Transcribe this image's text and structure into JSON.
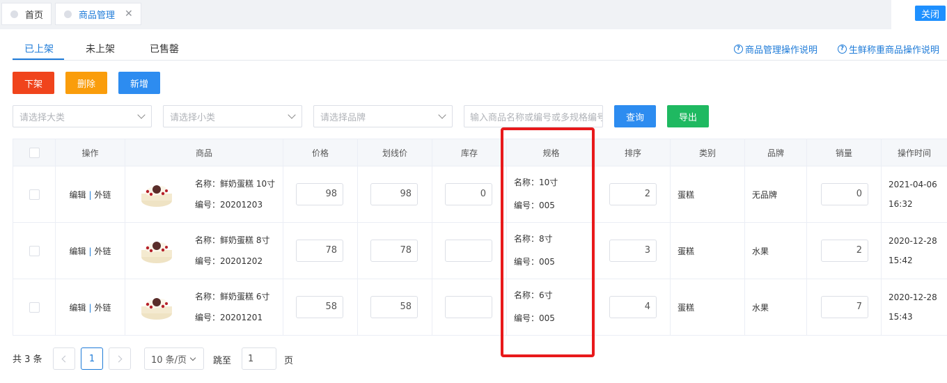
{
  "tabs": [
    {
      "label": "首页"
    },
    {
      "label": "商品管理"
    }
  ],
  "close_button": "关闭",
  "subtabs": [
    "已上架",
    "未上架",
    "已售罄"
  ],
  "help_links": [
    "商品管理操作说明",
    "生鲜称重商品操作说明"
  ],
  "actions": {
    "offshelf": "下架",
    "delete": "删除",
    "add": "新增"
  },
  "filters": {
    "category": "请选择大类",
    "subcategory": "请选择小类",
    "brand": "请选择品牌",
    "search_placeholder": "输入商品名称或编号或多规格编号",
    "query": "查询",
    "export": "导出"
  },
  "table": {
    "headers": [
      "操作",
      "商品",
      "价格",
      "划线价",
      "库存",
      "规格",
      "排序",
      "类别",
      "品牌",
      "销量",
      "操作时间"
    ],
    "edit_label": "编辑",
    "link_label": "外链",
    "rows": [
      {
        "name": "名称：鲜奶蛋糕 10寸",
        "code": "编号：20201203",
        "price": "98",
        "list_price": "98",
        "stock": "0",
        "spec_name": "名称：10寸",
        "spec_code": "编号：005",
        "sort": "2",
        "category": "蛋糕",
        "brand": "无品牌",
        "sales": "0",
        "date": "2021-04-06",
        "time": "16:32"
      },
      {
        "name": "名称：鲜奶蛋糕 8寸",
        "code": "编号：20201202",
        "price": "78",
        "list_price": "78",
        "stock": "",
        "spec_name": "名称：8寸",
        "spec_code": "编号：005",
        "sort": "3",
        "category": "蛋糕",
        "brand": "水果",
        "sales": "2",
        "date": "2020-12-28",
        "time": "15:42"
      },
      {
        "name": "名称：鲜奶蛋糕 6寸",
        "code": "编号：20201201",
        "price": "58",
        "list_price": "58",
        "stock": "",
        "spec_name": "名称：6寸",
        "spec_code": "编号：005",
        "sort": "4",
        "category": "蛋糕",
        "brand": "水果",
        "sales": "7",
        "date": "2020-12-28",
        "time": "15:43"
      }
    ]
  },
  "pagination": {
    "total": "共 3 条",
    "current_page": "1",
    "page_size": "10 条/页",
    "jump_label": "跳至",
    "jump_value": "1",
    "page_suffix": "页"
  },
  "colors": {
    "accent": "#1e7bd8",
    "danger": "#f0441c",
    "warning": "#fa9d0b",
    "success": "#1fb961",
    "highlight": "#e8191b"
  }
}
